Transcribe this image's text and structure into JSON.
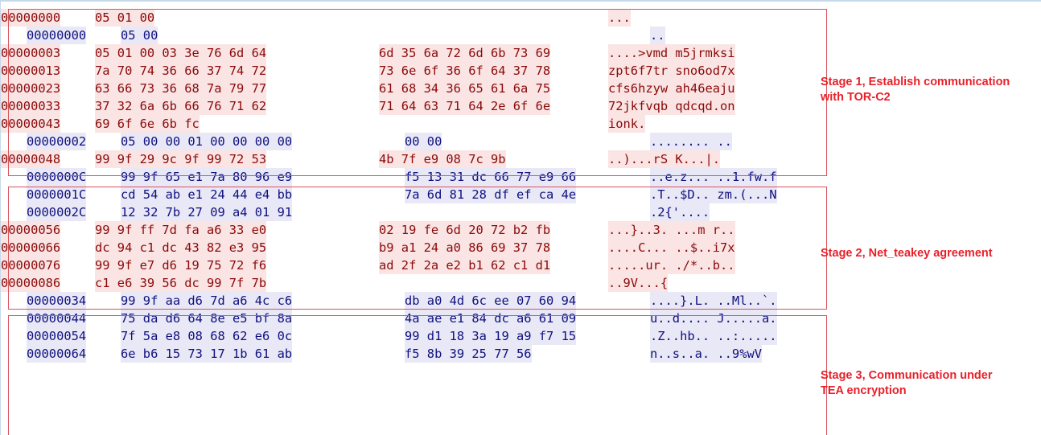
{
  "colors": {
    "sent_text": "#8b0a0a",
    "sent_bg": "#fae4e4",
    "recv_text": "#101080",
    "recv_bg": "#e8e8f6",
    "annotation": "#e8202a"
  },
  "lines": [
    {
      "dir": "sent",
      "offset": "00000000",
      "hex1": "05 01 00",
      "hex2": "",
      "ascii": "..."
    },
    {
      "dir": "recv",
      "offset": "00000000",
      "hex1": "05 00",
      "hex2": "",
      "ascii": ".."
    },
    {
      "dir": "sent",
      "offset": "00000003",
      "hex1": "05 01 00 03 3e 76 6d 64",
      "hex2": "6d 35 6a 72 6d 6b 73 69",
      "ascii": "....>vmd m5jrmksi"
    },
    {
      "dir": "sent",
      "offset": "00000013",
      "hex1": "7a 70 74 36 66 37 74 72",
      "hex2": "73 6e 6f 36 6f 64 37 78",
      "ascii": "zpt6f7tr sno6od7x"
    },
    {
      "dir": "sent",
      "offset": "00000023",
      "hex1": "63 66 73 36 68 7a 79 77",
      "hex2": "61 68 34 36 65 61 6a 75",
      "ascii": "cfs6hzyw ah46eaju"
    },
    {
      "dir": "sent",
      "offset": "00000033",
      "hex1": "37 32 6a 6b 66 76 71 62",
      "hex2": "71 64 63 71 64 2e 6f 6e",
      "ascii": "72jkfvqb qdcqd.on"
    },
    {
      "dir": "sent",
      "offset": "00000043",
      "hex1": "69 6f 6e 6b fc",
      "hex2": "",
      "ascii": "ionk."
    },
    {
      "dir": "recv",
      "offset": "00000002",
      "hex1": "05 00 00 01 00 00 00 00",
      "hex2": "00 00",
      "ascii": "........ .."
    },
    {
      "dir": "sent",
      "offset": "00000048",
      "hex1": "99 9f 29 9c 9f 99 72 53",
      "hex2": "4b 7f e9 08 7c 9b",
      "ascii": "..)...rS K...|."
    },
    {
      "dir": "recv",
      "offset": "0000000C",
      "hex1": "99 9f 65 e1 7a 80 96 e9",
      "hex2": "f5 13 31 dc 66 77 e9 66",
      "ascii": "..e.z... ..1.fw.f"
    },
    {
      "dir": "recv",
      "offset": "0000001C",
      "hex1": "cd 54 ab e1 24 44 e4 bb",
      "hex2": "7a 6d 81 28 df ef ca 4e",
      "ascii": ".T..$D.. zm.(...N"
    },
    {
      "dir": "recv",
      "offset": "0000002C",
      "hex1": "12 32 7b 27 09 a4 01 91",
      "hex2": "",
      "ascii": ".2{'...."
    },
    {
      "dir": "sent",
      "offset": "00000056",
      "hex1": "99 9f ff 7d fa a6 33 e0",
      "hex2": "02 19 fe 6d 20 72 b2 fb",
      "ascii": "...}..3. ...m r.."
    },
    {
      "dir": "sent",
      "offset": "00000066",
      "hex1": "dc 94 c1 dc 43 82 e3 95",
      "hex2": "b9 a1 24 a0 86 69 37 78",
      "ascii": "....C... ..$..i7x"
    },
    {
      "dir": "sent",
      "offset": "00000076",
      "hex1": "99 9f e7 d6 19 75 72 f6",
      "hex2": "ad 2f 2a e2 b1 62 c1 d1",
      "ascii": ".....ur. ./*..b.."
    },
    {
      "dir": "sent",
      "offset": "00000086",
      "hex1": "c1 e6 39 56 dc 99 7f 7b",
      "hex2": "",
      "ascii": "..9V...{"
    },
    {
      "dir": "recv",
      "offset": "00000034",
      "hex1": "99 9f aa d6 7d a6 4c c6",
      "hex2": "db a0 4d 6c ee 07 60 94",
      "ascii": "....}.L. ..Ml..`."
    },
    {
      "dir": "recv",
      "offset": "00000044",
      "hex1": "75 da d6 64 8e e5 bf 8a",
      "hex2": "4a ae e1 84 dc a6 61 09",
      "ascii": "u..d.... J.....a."
    },
    {
      "dir": "recv",
      "offset": "00000054",
      "hex1": "7f 5a e8 08 68 62 e6 0c",
      "hex2": "99 d1 18 3a 19 a9 f7 15",
      "ascii": ".Z..hb.. ..:....."
    },
    {
      "dir": "recv",
      "offset": "00000064",
      "hex1": "6e b6 15 73 17 1b 61 ab",
      "hex2": "f5 8b 39 25 77 56",
      "ascii": "n..s..a. ..9%wV"
    }
  ],
  "stages": [
    {
      "label": "Stage 1, Establish communication\nwith TOR-C2"
    },
    {
      "label": "Stage 2, Net_teakey agreement"
    },
    {
      "label": "Stage 3, Communication under\nTEA encryption"
    }
  ]
}
